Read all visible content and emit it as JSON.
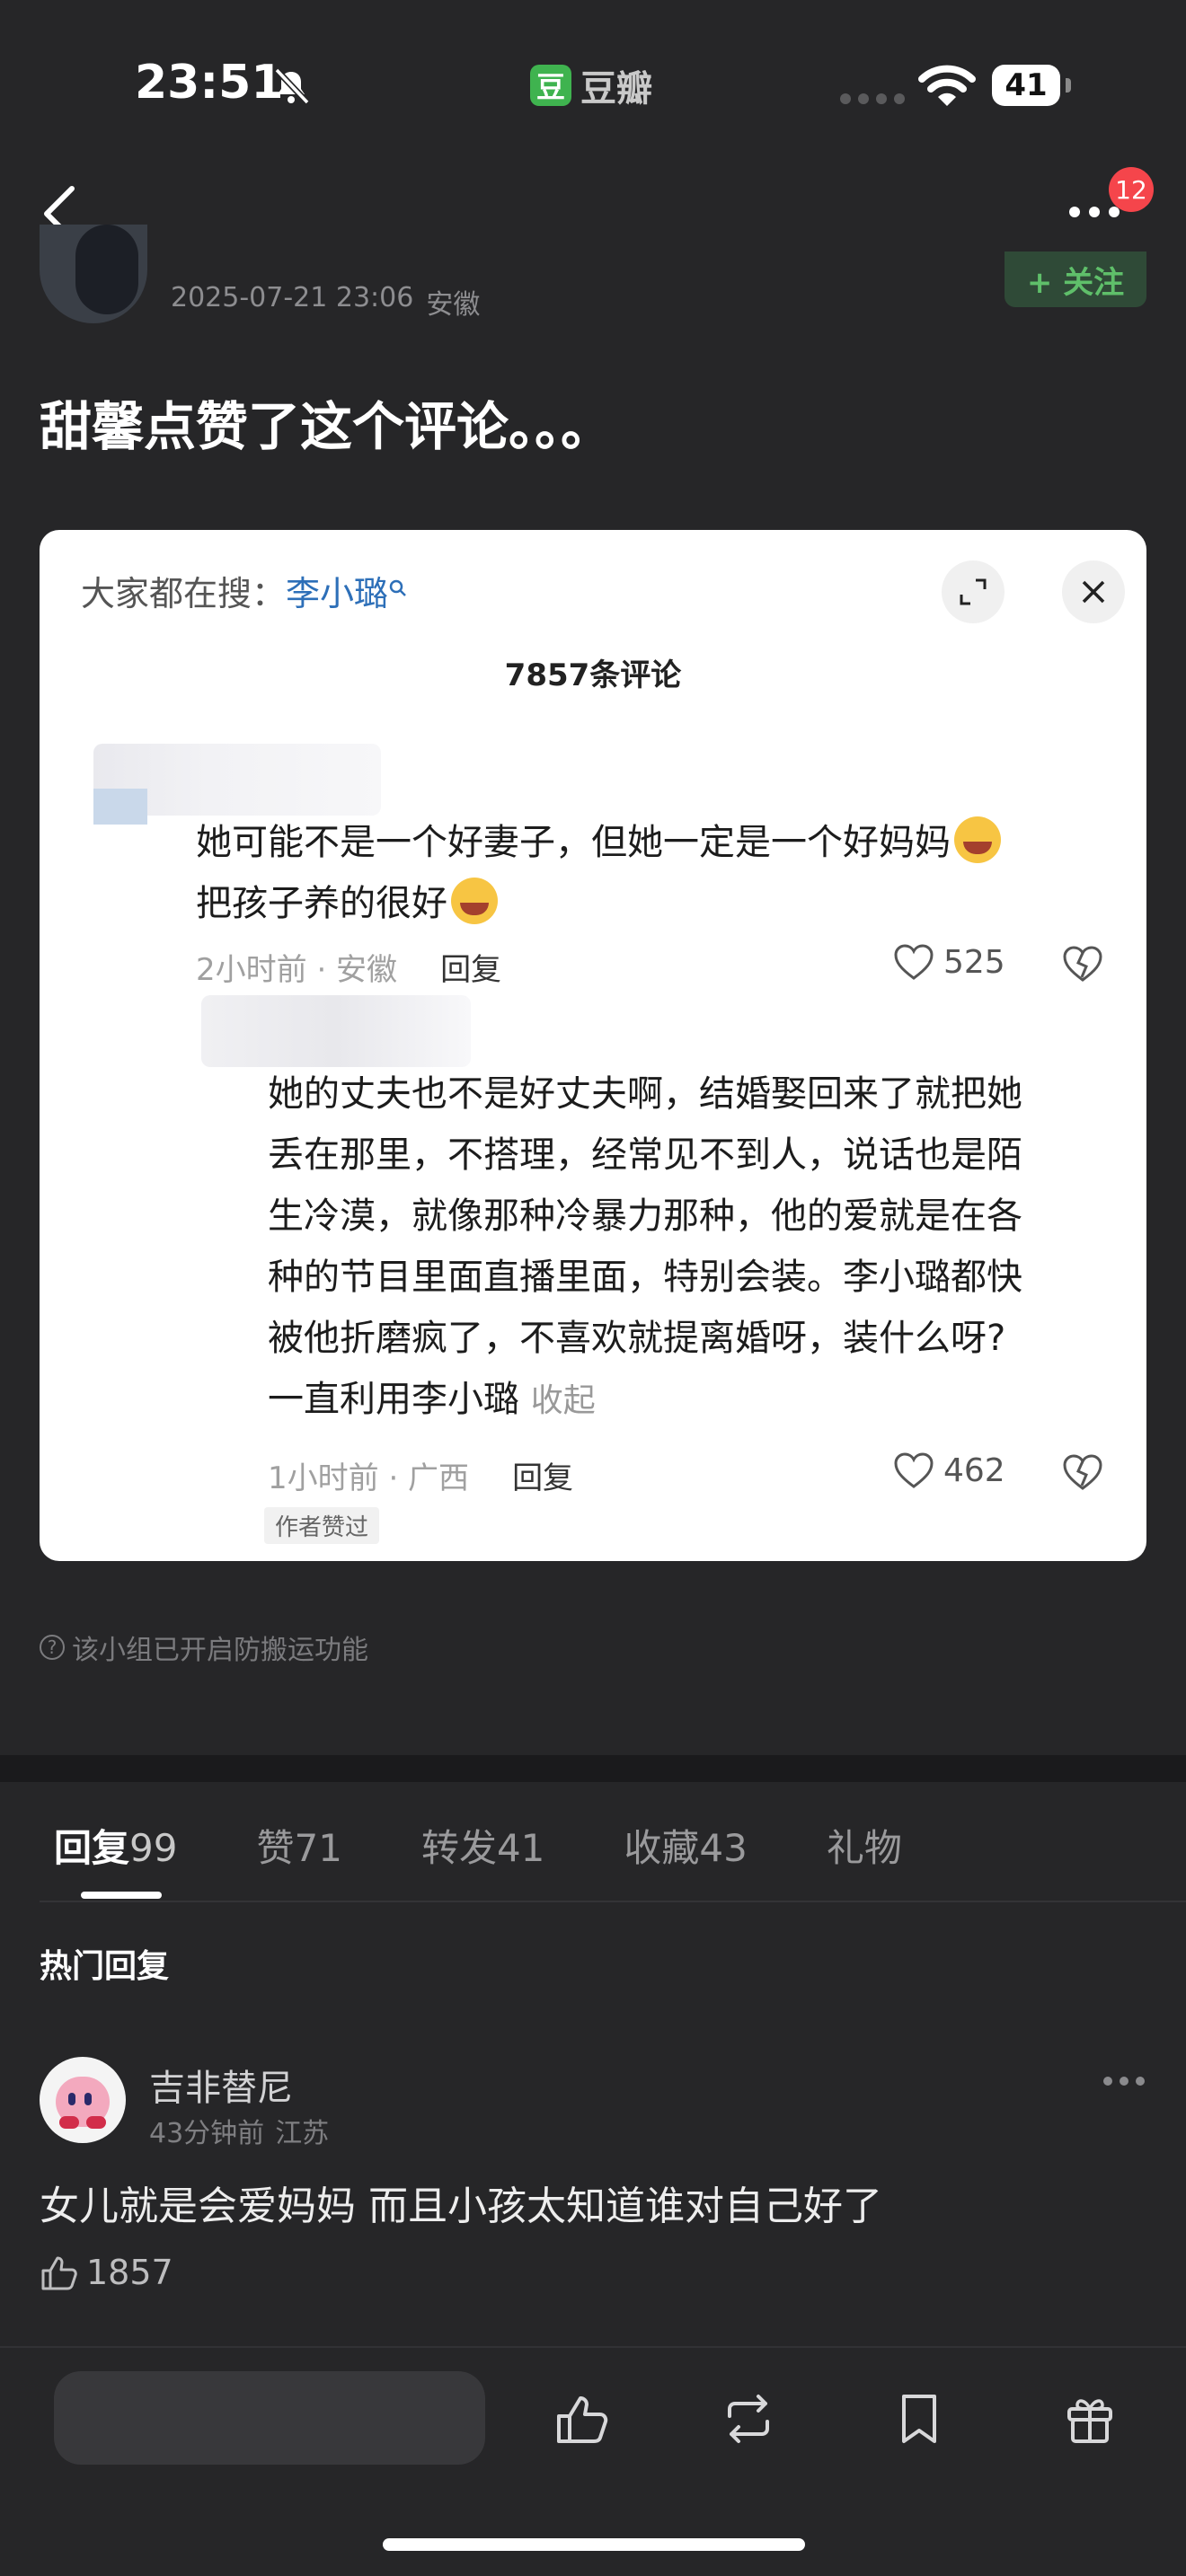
{
  "status_bar": {
    "time": "23:51",
    "battery": "41",
    "app_name": "豆瓣",
    "app_logo_char": "豆"
  },
  "nav": {
    "badge_count": "12"
  },
  "post": {
    "date": "2025-07-21 23:06",
    "location": "安徽",
    "follow_label": "+ 关注",
    "title": "甜馨点赞了这个评论。。。"
  },
  "card": {
    "search_prefix": "大家都在搜：",
    "search_keyword": "李小璐",
    "comment_count": "7857条评论",
    "comments": [
      {
        "line1": "她可能不是一个好妻子，但她一定是一个好妈妈",
        "line2": "把孩子养的很好",
        "time": "2小时前 · 安徽",
        "reply": "回复",
        "likes": "525"
      },
      {
        "lines": [
          "她的丈夫也不是好丈夫啊，结婚娶回来了就把她",
          "丢在那里，不搭理，经常见不到人，说话也是陌",
          "生冷漠，就像那种冷暴力那种，他的爱就是在各",
          "种的节目里面直播里面，特别会装。李小璐都快",
          "被他折磨疯了，不喜欢就提离婚呀，装什么呀?"
        ],
        "last_line": "一直利用李小璐",
        "fold": "收起",
        "time": "1小时前 · 广西",
        "reply": "回复",
        "likes": "462",
        "author_tag": "作者赞过"
      }
    ]
  },
  "anti_copy_notice": "该小组已开启防搬运功能",
  "tabs": [
    {
      "label": "回复",
      "count": "99"
    },
    {
      "label": "赞",
      "count": "71"
    },
    {
      "label": "转发",
      "count": "41"
    },
    {
      "label": "收藏",
      "count": "43"
    },
    {
      "label": "礼物",
      "count": ""
    }
  ],
  "hot_replies_title": "热门回复",
  "reply": {
    "name": "吉非替尼",
    "time": "43分钟前",
    "location": "江苏",
    "text": "女儿就是会爱妈妈 而且小孩太知道谁对自己好了",
    "likes": "1857"
  },
  "icons": {
    "bell_off": "bell-slash-icon",
    "wifi": "wifi-icon",
    "back": "chevron-left-icon",
    "more": "ellipsis-icon",
    "expand": "expand-icon",
    "close": "close-icon",
    "heart": "heart-icon",
    "broken_heart": "broken-heart-icon",
    "thumb": "thumb-up-icon",
    "repost": "repost-icon",
    "bookmark": "bookmark-icon",
    "gift": "gift-icon"
  }
}
